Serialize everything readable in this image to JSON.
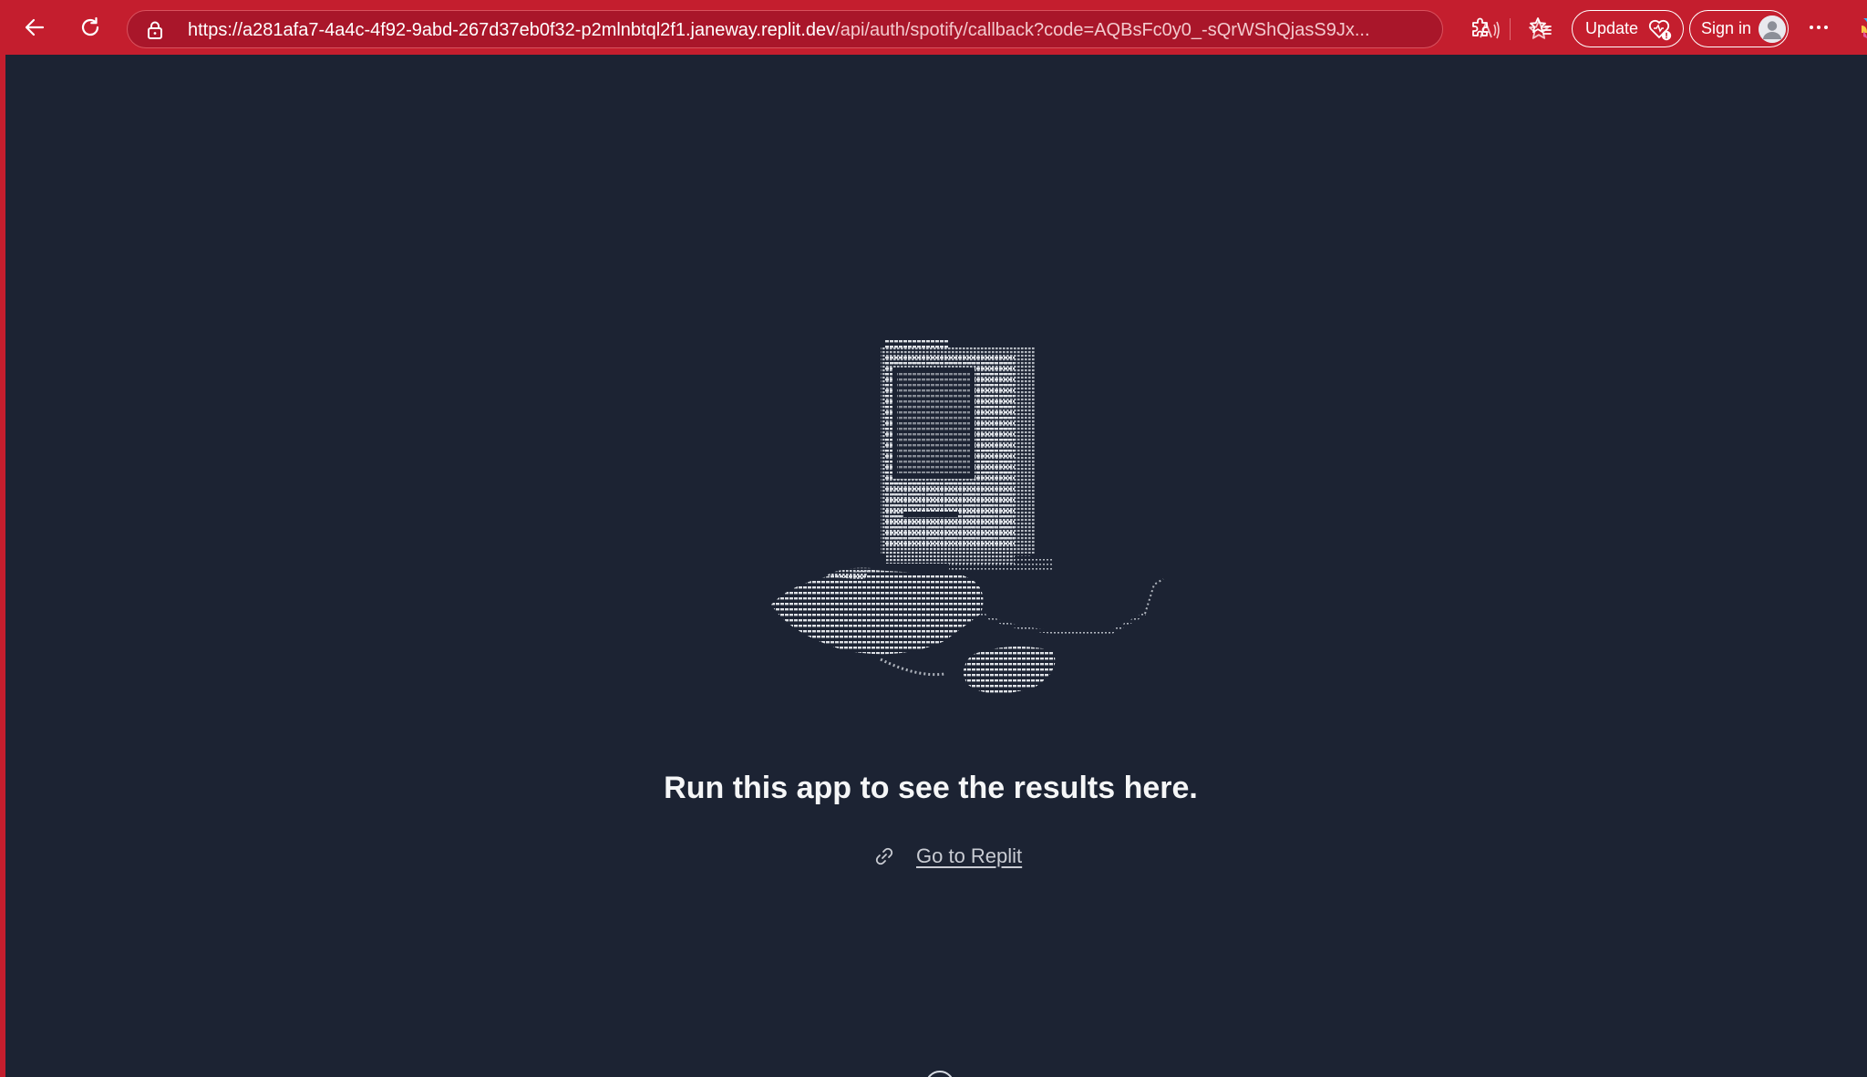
{
  "browser": {
    "address_bar": {
      "url_host_part": "https://a281afa7-4a4c-4f92-9abd-267d37eb0f32-p2mlnbtql2f1.janeway.replit.dev",
      "url_path_part": "/api/auth/spotify/callback?code=AQBsFc0y0_-sQrWShQjasS9Jx..."
    },
    "update_label": "Update",
    "signin_label": "Sign in",
    "colors": {
      "toolbar": "#c41e2e",
      "page_background": "#1c2333"
    },
    "icons": {
      "back": "back-arrow-icon",
      "refresh": "refresh-icon",
      "lock": "lock-icon",
      "read_aloud": "read-aloud-icon",
      "favorite": "star-icon",
      "extensions": "puzzle-icon",
      "favorites": "favorites-icon",
      "update": "heart-update-icon",
      "more": "more-icon"
    }
  },
  "page": {
    "headline": "Run this app to see the results here.",
    "link_label": "Go to Replit",
    "link_icon": "link-icon",
    "illustration": "ascii-art-computer-illustration"
  }
}
